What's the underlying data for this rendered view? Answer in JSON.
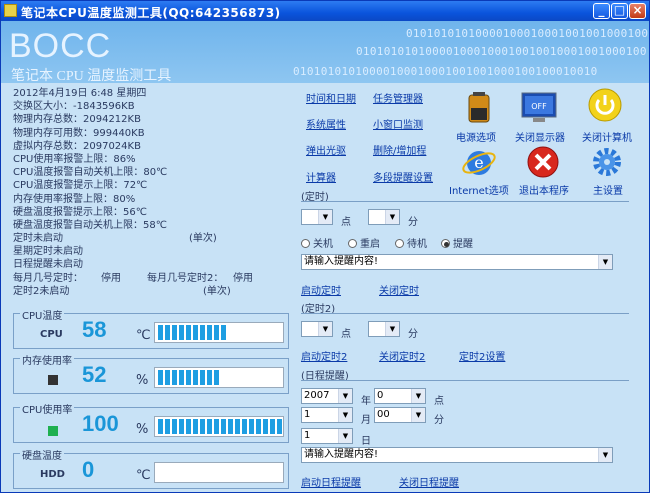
{
  "window": {
    "title": "笔记本CPU温度监测工具(QQ:642356873)",
    "min_label": "_",
    "max_label": "□",
    "close_label": "×"
  },
  "banner": {
    "logo": "BOCC",
    "subtitle": "笔记本 CPU 温度监测工具",
    "binary_row1": "0101010101000010001000100100100010010001",
    "binary_row2": "010101010100001000100010010010001001000100",
    "binary_row3": "01010101010000100010001001001000100100010010"
  },
  "info": {
    "datetime": "2012年4月19日 6:48 星期四",
    "swap": "交换区大小：-1843596KB",
    "phys_total": "物理内存总数：2094212KB",
    "phys_avail": "物理内存可用数：999440KB",
    "virt_total": "虚拟内存总数：2097024KB",
    "cpu_alarm": "CPU使用率报警上限：86%",
    "cpu_temp_shutdown": "CPU温度报警自动关机上限：80℃",
    "cpu_temp_alarm": "CPU温度报警提示上限：72℃",
    "mem_alarm": "内存使用率报警上限：80%",
    "disk_temp_alarm": "硬盘温度报警提示上限：56℃",
    "disk_temp_shutdown": "硬盘温度报警自动关机上限：58℃",
    "timer1": "定时未启动",
    "timer1_mode": "(单次)",
    "week_timer": "星期定时未启动",
    "schedule": "日程提醒未启动",
    "monthly": "每月几号定时：",
    "monthly_val": "停用",
    "monthly2": "每月几号定时2：",
    "monthly2_val": "停用",
    "timer2": "定时2未启动",
    "timer2_mode": "(单次)"
  },
  "gauges": [
    {
      "group": "CPU温度",
      "label": "CPU",
      "value": "58",
      "unit": "℃",
      "fill": 0.58
    },
    {
      "group": "内存使用率",
      "label": "",
      "value": "52",
      "unit": "%",
      "fill": 0.52
    },
    {
      "group": "CPU使用率",
      "label": "",
      "value": "100",
      "unit": "%",
      "fill": 1.0
    },
    {
      "group": "硬盘温度",
      "label": "HDD",
      "value": "0",
      "unit": "℃",
      "fill": 0.0
    }
  ],
  "links": {
    "time_date": "时间和日期",
    "task_mgr": "任务管理器",
    "sys_props": "系统属性",
    "mini_monitor": "小窗口监测",
    "eject_cd": "弹出光驱",
    "add_remove": "删除/增加程",
    "calculator": "计算器",
    "multi_reminder": "多段提醒设置"
  },
  "tools": {
    "power": "电源选项",
    "display_off": "关闭显示器",
    "shutdown": "关闭计算机",
    "ie": "Internet选项",
    "exit": "退出本程序",
    "settings": "主设置",
    "display_off_text": "OFF"
  },
  "timer": {
    "section": "(定时)",
    "hour_label": "点",
    "min_label": "分",
    "radios": [
      "关机",
      "重启",
      "待机",
      "提醒"
    ],
    "reminder_placeholder": "请输入提醒内容!",
    "start": "启动定时",
    "stop": "关闭定时"
  },
  "timer2": {
    "section": "(定时2)",
    "hour_label": "点",
    "min_label": "分",
    "start": "启动定时2",
    "stop": "关闭定时2",
    "settings": "定时2设置"
  },
  "schedule": {
    "section": "(日程提醒)",
    "year": "2007",
    "year_label": "年",
    "hour": "0",
    "hour_label": "点",
    "month": "1",
    "month_label": "月",
    "minute": "00",
    "minute_label": "分",
    "day": "1",
    "day_label": "日",
    "reminder_placeholder": "请输入提醒内容!",
    "start": "启动日程提醒",
    "stop": "关闭日程提醒"
  }
}
